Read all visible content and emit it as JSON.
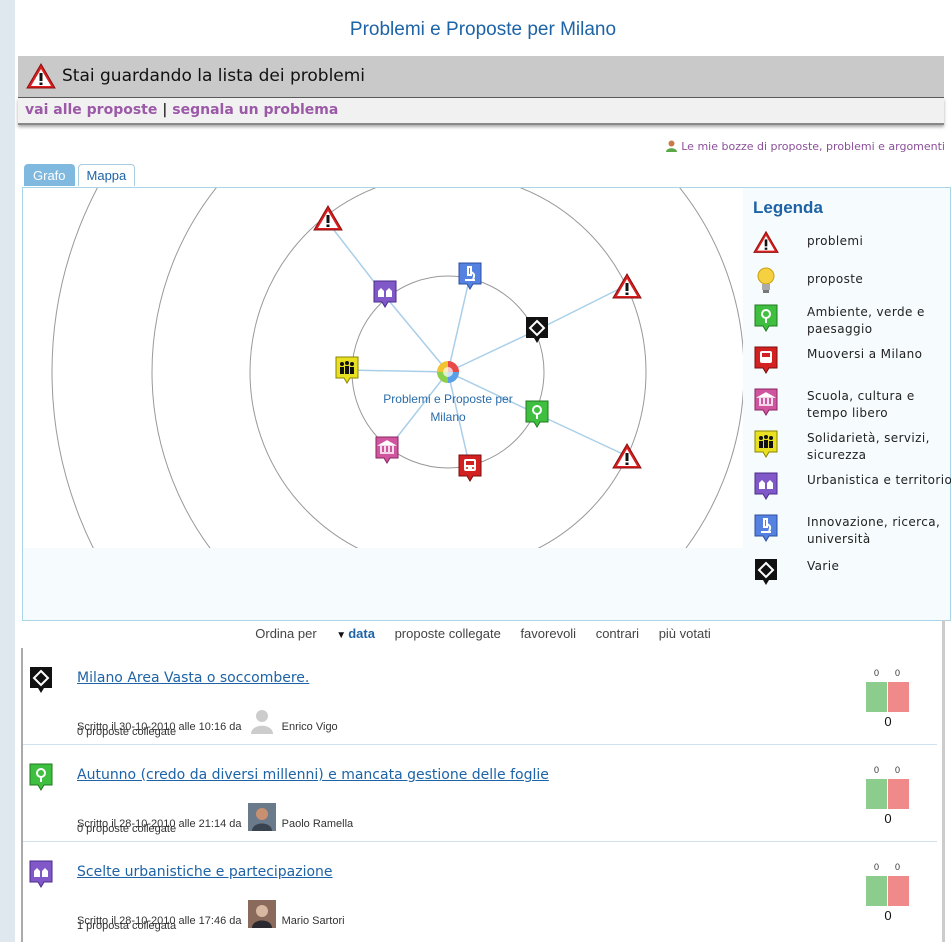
{
  "site": {
    "title": "Problemi e Proposte per Milano"
  },
  "banner": {
    "message": "Stai guardando la lista dei problemi",
    "link_proposals": "vai alle proposte",
    "separator": "|",
    "link_report": "segnala un problema"
  },
  "drafts_link": "Le mie bozze di proposte, problemi e argomenti",
  "tabs": [
    {
      "label": "Grafo",
      "active": true
    },
    {
      "label": "Mappa",
      "active": false
    }
  ],
  "graph": {
    "hub_label_1": "Problemi e Proposte per",
    "hub_label_2": "Milano"
  },
  "legend": {
    "title": "Legenda",
    "items": [
      {
        "icon": "warning-icon",
        "label": "problemi"
      },
      {
        "icon": "bulb-icon",
        "label": "proposte"
      },
      {
        "icon": "environment-icon",
        "label": "Ambiente, verde e paesaggio",
        "color": "#3fbf3f"
      },
      {
        "icon": "bus-icon",
        "label": "Muoversi a Milano",
        "color": "#d32020"
      },
      {
        "icon": "museum-icon",
        "label": "Scuola, cultura e tempo libero",
        "color": "#d0559f"
      },
      {
        "icon": "people-icon",
        "label": "Solidarietà, servizi, sicurezza",
        "color": "#e8e020"
      },
      {
        "icon": "houses-icon",
        "label": "Urbanistica e territorio",
        "color": "#8058c8"
      },
      {
        "icon": "microscope-icon",
        "label": "Innovazione, ricerca, università",
        "color": "#5582e0"
      },
      {
        "icon": "diamond-icon",
        "label": "Varie",
        "color": "#111111"
      }
    ]
  },
  "sort": {
    "label": "Ordina per",
    "options": [
      "data",
      "proposte collegate",
      "favorevoli",
      "contrari",
      "più votati"
    ],
    "active": "data"
  },
  "problems": [
    {
      "category": "diamond-icon",
      "title": "Milano Area Vasta o soccombere.",
      "written_prefix": "Scritto il 30-10-2010 alle 10:16 da",
      "author": "Enrico Vigo",
      "linked": "0 proposte collegate",
      "votes_for": "0",
      "votes_against": "0",
      "total": "0"
    },
    {
      "category": "environment-icon",
      "title": "Autunno (credo da diversi millenni) e mancata gestione delle foglie",
      "written_prefix": "Scritto il 28-10-2010 alle 21:14 da",
      "author": "Paolo Ramella",
      "linked": "0 proposte collegate",
      "votes_for": "0",
      "votes_against": "0",
      "total": "0"
    },
    {
      "category": "houses-icon",
      "title": "Scelte urbanistiche e partecipazione",
      "written_prefix": "Scritto il 28-10-2010 alle 17:46 da",
      "author": "Mario Sartori",
      "linked": "1 proposta collegata",
      "votes_for": "0",
      "votes_against": "0",
      "total": "0"
    }
  ]
}
